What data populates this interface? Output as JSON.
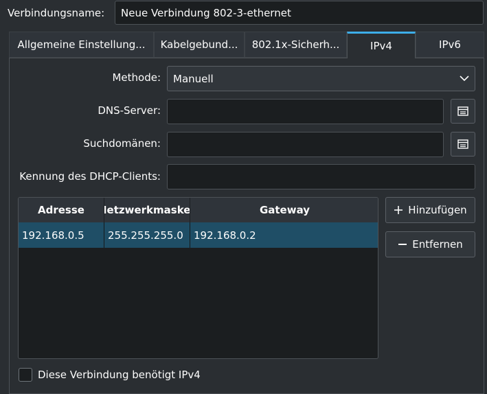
{
  "connection": {
    "name_label": "Verbindungsname:",
    "name_value": "Neue Verbindung 802-3-ethernet"
  },
  "tabs": [
    {
      "label": "Allgemeine Einstellung..."
    },
    {
      "label": "Kabelgebund..."
    },
    {
      "label": "802.1x-Sicherh..."
    },
    {
      "label": "IPv4"
    },
    {
      "label": "IPv6"
    }
  ],
  "ipv4": {
    "method_label": "Methode:",
    "method_value": "Manuell",
    "dns_label": "DNS-Server:",
    "dns_value": "",
    "search_label": "Suchdomänen:",
    "search_value": "",
    "dhcp_label": "Kennung des DHCP-Clients:",
    "dhcp_value": "",
    "table": {
      "headers": [
        "Adresse",
        "Netzwerkmaske",
        "Gateway"
      ],
      "rows": [
        [
          "192.168.0.5",
          "255.255.255.0",
          "192.168.0.2"
        ]
      ]
    },
    "add_button": "Hinzufügen",
    "remove_button": "Entfernen",
    "requires_label": "Diese Verbindung benötigt IPv4",
    "requires_checked": false
  },
  "colors": {
    "accent": "#3daee9",
    "selected_row": "#1f4e66"
  }
}
